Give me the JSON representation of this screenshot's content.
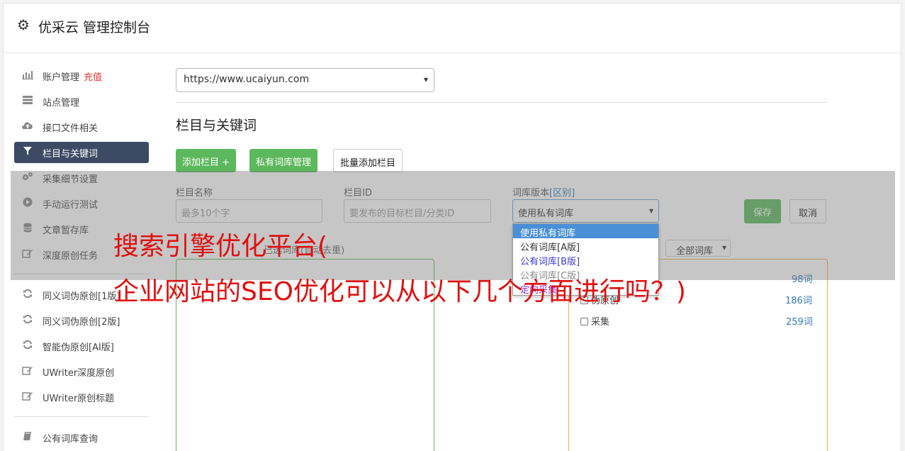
{
  "header": {
    "title": "优采云 管理控制台"
  },
  "sidebar": {
    "items": [
      {
        "label": "账户管理",
        "badge": "充值",
        "icon": "bar-chart-icon"
      },
      {
        "label": "站点管理",
        "icon": "server-icon"
      },
      {
        "label": "接口文件相关",
        "icon": "cloud-upload-icon"
      },
      {
        "label": "栏目与关键词",
        "icon": "filter-icon",
        "active": true
      },
      {
        "label": "采集细节设置",
        "icon": "cogs-icon"
      },
      {
        "label": "手动运行测试",
        "icon": "play-icon"
      },
      {
        "label": "文章暂存库",
        "icon": "database-icon"
      },
      {
        "label": "深度原创任务",
        "icon": "edit-icon"
      }
    ],
    "items2": [
      {
        "label": "同义词伪原创[1版]",
        "icon": "refresh-icon"
      },
      {
        "label": "同义词伪原创[2版]",
        "icon": "refresh-icon"
      },
      {
        "label": "智能伪原创[AI版]",
        "icon": "refresh-icon"
      },
      {
        "label": "UWriter深度原创",
        "icon": "edit-icon"
      },
      {
        "label": "UWriter原创标题",
        "icon": "edit-icon"
      }
    ],
    "items3": [
      {
        "label": "公有词库查询",
        "icon": "book-icon"
      }
    ]
  },
  "main": {
    "site_select_value": "https://www.ucaiyun.com",
    "section_title": "栏目与关键词",
    "buttons": {
      "add_column": "添加栏目 +",
      "private_lib": "私有词库管理",
      "batch_add": "批量添加栏目"
    },
    "form": {
      "name_label": "栏目名称",
      "name_placeholder": "最多10个字",
      "id_label": "栏目ID",
      "id_placeholder": "要发布的目标栏目/分类ID",
      "version_label": "词库版本",
      "version_diff": "[区别]",
      "version_value": "使用私有词库",
      "save": "保存",
      "cancel": "取消"
    },
    "dropdown_options": [
      "使用私有词库",
      "公有词库[A版]",
      "公有词库[B版]",
      "公有词库[C版]",
      "定向采集"
    ],
    "left_panel_title": "已选词库(自动去重)",
    "filter_select": "全部词库",
    "right_list": [
      {
        "label": "",
        "count": "98词"
      },
      {
        "label": "伪原创",
        "count": "186词"
      },
      {
        "label": "采集",
        "count": "259词"
      }
    ]
  },
  "watermark": {
    "line1": "搜索引擎优化平台(",
    "line2": "企业网站的SEO优化可以从以下几个方面进行吗？)"
  },
  "colors": {
    "accent": "#5cb85c",
    "active_nav": "#3c4a63",
    "link": "#337ab7",
    "watermark": "#e01010"
  }
}
